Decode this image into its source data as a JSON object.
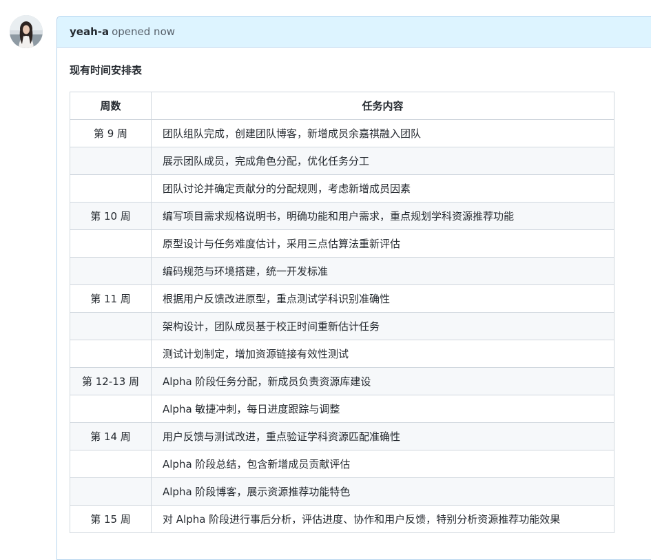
{
  "comment": {
    "author": "yeah-a",
    "action": "opened now",
    "title": "现有时间安排表"
  },
  "table": {
    "headers": [
      "周数",
      "任务内容"
    ],
    "rows": [
      {
        "week": "第 9 周",
        "task": "团队组队完成，创建团队博客，新增成员余嘉祺融入团队"
      },
      {
        "week": "",
        "task": "展示团队成员，完成角色分配，优化任务分工"
      },
      {
        "week": "",
        "task": "团队讨论并确定贡献分的分配规则，考虑新增成员因素"
      },
      {
        "week": "第 10 周",
        "task": "编写项目需求规格说明书，明确功能和用户需求，重点规划学科资源推荐功能"
      },
      {
        "week": "",
        "task": "原型设计与任务难度估计，采用三点估算法重新评估"
      },
      {
        "week": "",
        "task": "编码规范与环境搭建，统一开发标准"
      },
      {
        "week": "第 11 周",
        "task": "根据用户反馈改进原型，重点测试学科识别准确性"
      },
      {
        "week": "",
        "task": "架构设计，团队成员基于校正时间重新估计任务"
      },
      {
        "week": "",
        "task": "测试计划制定，增加资源链接有效性测试"
      },
      {
        "week": "第 12-13 周",
        "task": "Alpha 阶段任务分配，新成员负责资源库建设"
      },
      {
        "week": "",
        "task": "Alpha 敏捷冲刺，每日进度跟踪与调整"
      },
      {
        "week": "第 14 周",
        "task": "用户反馈与测试改进，重点验证学科资源匹配准确性"
      },
      {
        "week": "",
        "task": "Alpha 阶段总结，包含新增成员贡献评估"
      },
      {
        "week": "",
        "task": "Alpha 阶段博客，展示资源推荐功能特色"
      },
      {
        "week": "第 15 周",
        "task": "对 Alpha 阶段进行事后分析，评估进度、协作和用户反馈，特别分析资源推荐功能效果"
      }
    ]
  }
}
